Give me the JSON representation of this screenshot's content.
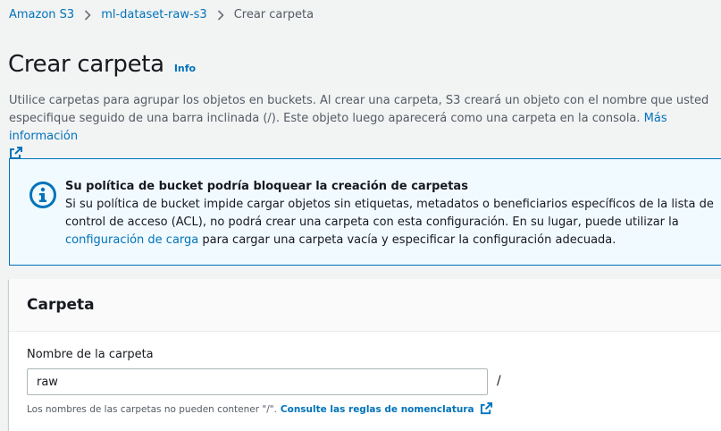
{
  "breadcrumb": {
    "items": [
      "Amazon S3",
      "ml-dataset-raw-s3"
    ],
    "current": "Crear carpeta"
  },
  "header": {
    "title": "Crear carpeta",
    "info_link": "Info"
  },
  "description": {
    "text": "Utilice carpetas para agrupar los objetos en buckets. Al crear una carpeta, S3 creará un objeto con el nombre que usted especifique seguido de una barra inclinada (/). Este objeto luego aparecerá como una carpeta en la consola.",
    "link": "Más información"
  },
  "alert": {
    "title": "Su política de bucket podría bloquear la creación de carpetas",
    "body_before_link": "Si su política de bucket impide cargar objetos sin etiquetas, metadatos o beneficiarios específicos de la lista de control de acceso (ACL), no podrá crear una carpeta con esta configuración. En su lugar, puede utilizar la",
    "link": "configuración de carga",
    "body_after_link": "para cargar una carpeta vacía y especificar la configuración adecuada."
  },
  "panel": {
    "title": "Carpeta",
    "field_label": "Nombre de la carpeta",
    "field_value": "raw",
    "suffix": "/",
    "constraint_text": "Los nombres de las carpetas no pueden contener \"/\".",
    "constraint_link": "Consulte las reglas de nomenclatura"
  },
  "colors": {
    "link": "#0073bb",
    "background": "#f2f3f3",
    "alert_background": "#f1faff",
    "alert_border": "#0073bb",
    "text": "#16191f",
    "secondary_text": "#545b64"
  },
  "icons": [
    "chevron-right-icon",
    "external-link-icon",
    "info-circle-icon"
  ]
}
